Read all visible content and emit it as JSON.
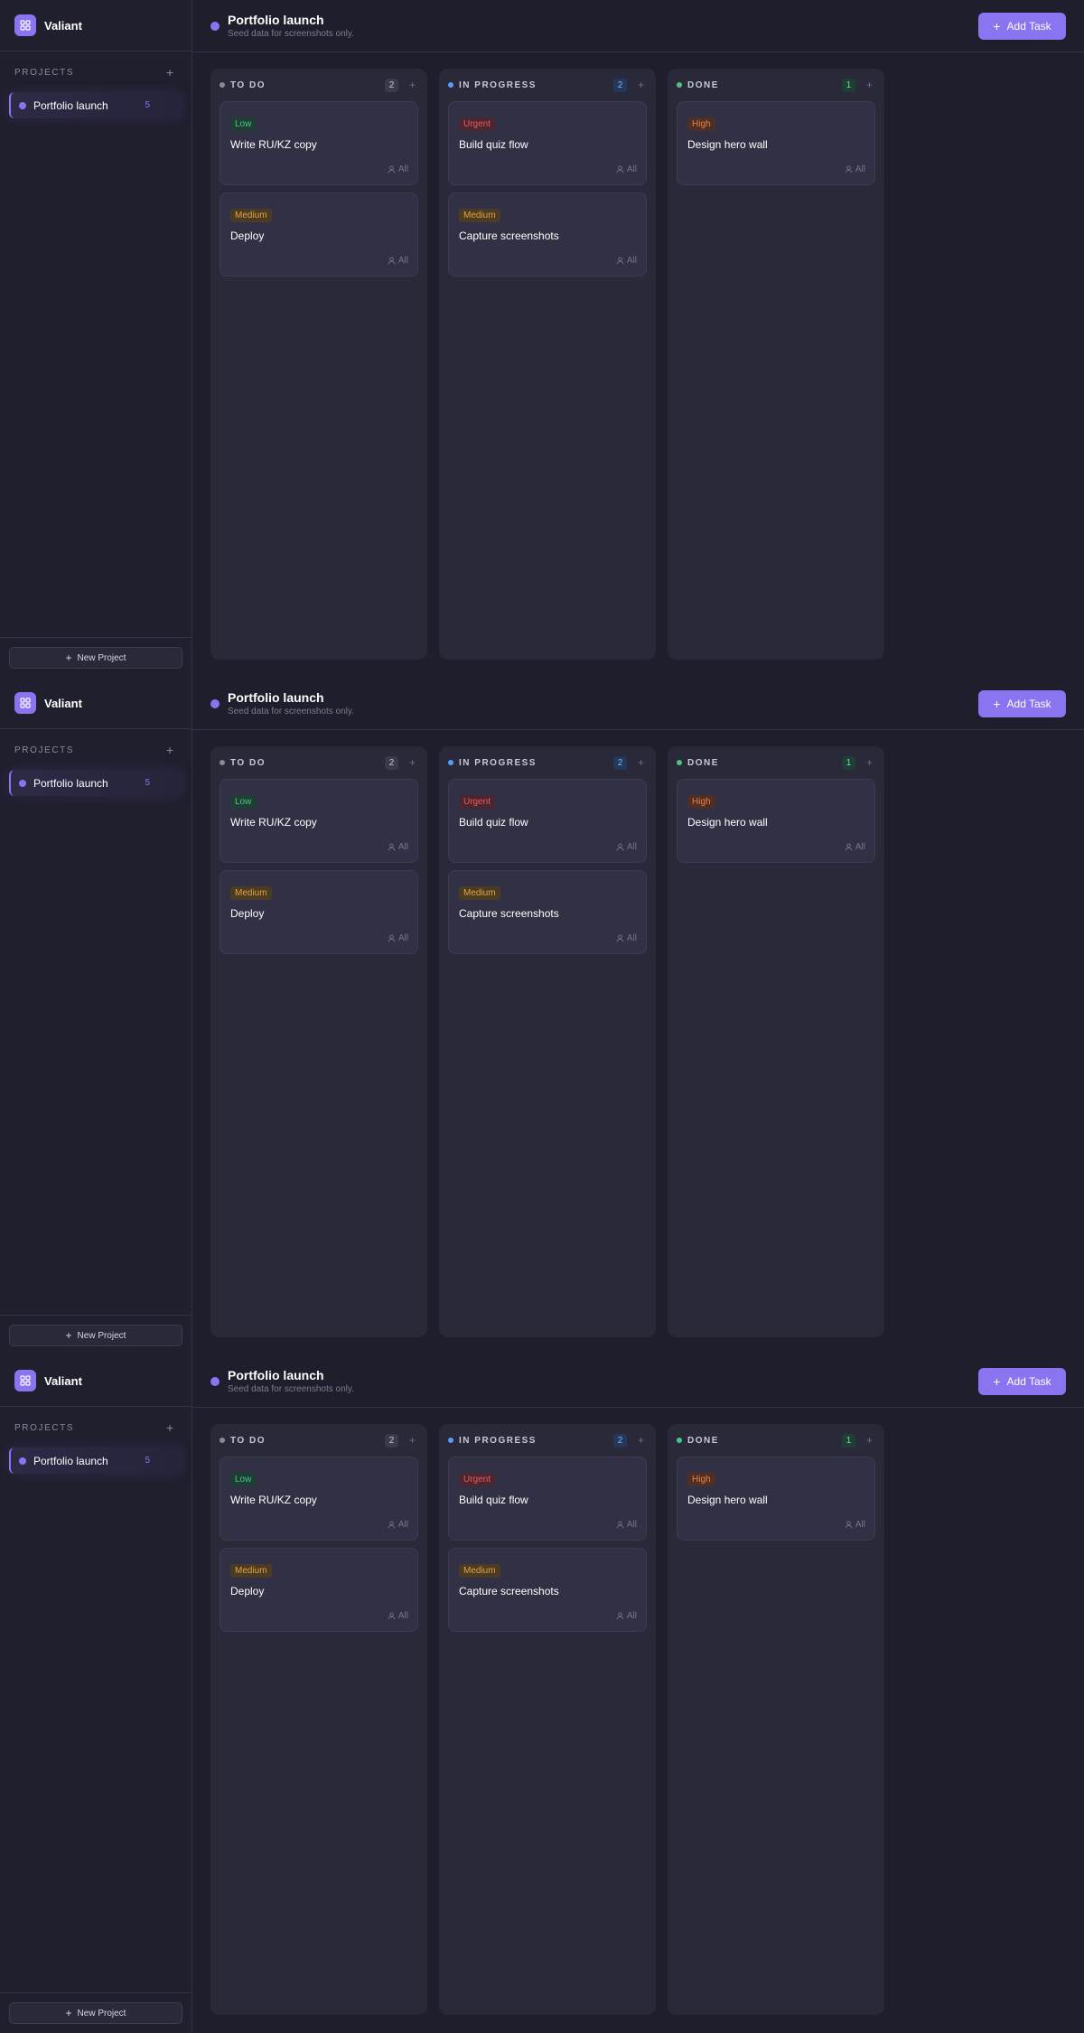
{
  "brand": {
    "name": "Valiant"
  },
  "sidebar": {
    "projects_label": "PROJECTS",
    "projects": [
      {
        "name": "Portfolio launch",
        "count": "5"
      }
    ],
    "new_project_label": "New Project"
  },
  "header": {
    "title": "Portfolio launch",
    "subtitle": "Seed data for screenshots only.",
    "add_task_label": "Add Task"
  },
  "columns": [
    {
      "title": "TO DO",
      "count": "2",
      "dot_color": "#8a89a0",
      "count_bg": "#3a394d",
      "count_color": "#c9c8d8",
      "cards": [
        {
          "priority": "Low",
          "priority_color": "#4cc38a",
          "priority_bg": "#1f3f34",
          "title": "Write RU/KZ copy",
          "assignee": "All"
        },
        {
          "priority": "Medium",
          "priority_color": "#e9a23b",
          "priority_bg": "#4a3b25",
          "title": "Deploy",
          "assignee": "All"
        }
      ]
    },
    {
      "title": "IN PROGRESS",
      "count": "2",
      "dot_color": "#5a9cf5",
      "count_bg": "#24385a",
      "count_color": "#7fb1f7",
      "cards": [
        {
          "priority": "Urgent",
          "priority_color": "#ef5a5a",
          "priority_bg": "#4a2630",
          "title": "Build quiz flow",
          "assignee": "All"
        },
        {
          "priority": "Medium",
          "priority_color": "#e9a23b",
          "priority_bg": "#4a3b25",
          "title": "Capture screenshots",
          "assignee": "All"
        }
      ]
    },
    {
      "title": "DONE",
      "count": "1",
      "dot_color": "#4cc38a",
      "count_bg": "#1f3f34",
      "count_color": "#6fd8a5",
      "cards": [
        {
          "priority": "High",
          "priority_color": "#f27e46",
          "priority_bg": "#4d2f25",
          "title": "Design hero wall",
          "assignee": "All"
        }
      ]
    }
  ],
  "colors": {
    "accent": "#8b74f0",
    "background": "#1f1e2c",
    "column_bg": "#2a293a",
    "card_bg": "#313044"
  },
  "icons": {
    "brand": "grid-icon",
    "add": "plus-icon",
    "assignee": "user-icon"
  }
}
